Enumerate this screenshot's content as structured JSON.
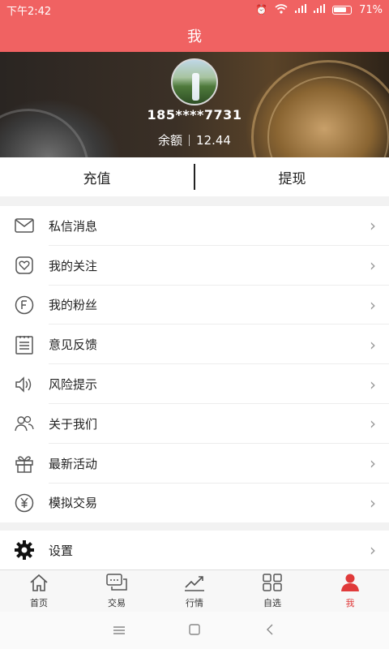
{
  "status_bar": {
    "time": "下午2:42",
    "battery": "71%"
  },
  "title": "我",
  "profile": {
    "phone": "185****7731",
    "balance_label": "余额",
    "balance_value": "12.44"
  },
  "actions": {
    "recharge": "充值",
    "withdraw": "提现"
  },
  "menu": [
    {
      "label": "私信消息",
      "icon": "mail-icon"
    },
    {
      "label": "我的关注",
      "icon": "heart-icon"
    },
    {
      "label": "我的粉丝",
      "icon": "fans-icon"
    },
    {
      "label": "意见反馈",
      "icon": "feedback-icon"
    },
    {
      "label": "风险提示",
      "icon": "speaker-icon"
    },
    {
      "label": "关于我们",
      "icon": "people-icon"
    },
    {
      "label": "最新活动",
      "icon": "gift-icon"
    },
    {
      "label": "模拟交易",
      "icon": "yuan-icon"
    }
  ],
  "settings": {
    "label": "设置",
    "icon": "gear-icon"
  },
  "tabs": [
    {
      "label": "首页",
      "icon": "home-icon"
    },
    {
      "label": "交易",
      "icon": "chat-icon"
    },
    {
      "label": "行情",
      "icon": "trend-icon"
    },
    {
      "label": "自选",
      "icon": "grid-icon"
    },
    {
      "label": "我",
      "icon": "user-icon",
      "active": true
    }
  ],
  "colors": {
    "brand": "#f06262",
    "active_tab": "#e03a3a"
  }
}
